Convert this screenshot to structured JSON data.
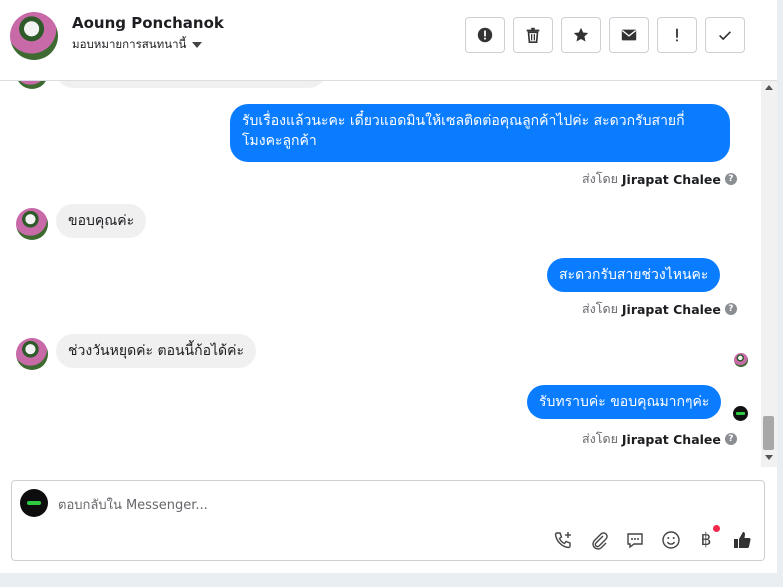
{
  "header": {
    "contact_name": "Aoung Ponchanok",
    "assign_label": "มอบหมายการสนทนานี้",
    "actions": [
      "mark-spam",
      "delete",
      "star",
      "mark-unread",
      "follow-up",
      "mark-done"
    ]
  },
  "messages": [
    {
      "from": "page",
      "text_line1": "รับเรื่องแล้วนะคะ เดี๋ยวแอดมินให้เซลติดต่อคุณลูกค้าไปค่ะ สะดวกรับสายกี่",
      "text_line2": "โมงคะลูกค้า"
    },
    {
      "from": "contact",
      "text": "ขอบคุณค่ะ"
    },
    {
      "from": "page",
      "text": "สะดวกรับสายช่วงไหนคะ"
    },
    {
      "from": "contact",
      "text": "ช่วงวันหยุดค่ะ ตอนนี้ก้อได้ค่ะ"
    },
    {
      "from": "page",
      "text": "รับทราบค่ะ ขอบคุณมากๆค่ะ"
    }
  ],
  "sent_by": {
    "prefix": "ส่งโดย",
    "name": "Jirapat Chalee",
    "help": "?"
  },
  "composer": {
    "placeholder": "ตอบกลับใน Messenger...",
    "tools": [
      "add-call-icon",
      "attachment-icon",
      "saved-reply-icon",
      "emoji-icon",
      "baht-payment-icon",
      "like-icon"
    ],
    "baht_symbol": "฿"
  },
  "colors": {
    "outgoing_bubble": "#0a7cff",
    "incoming_bubble": "#f0f0f0",
    "notification_dot": "#f02849"
  }
}
